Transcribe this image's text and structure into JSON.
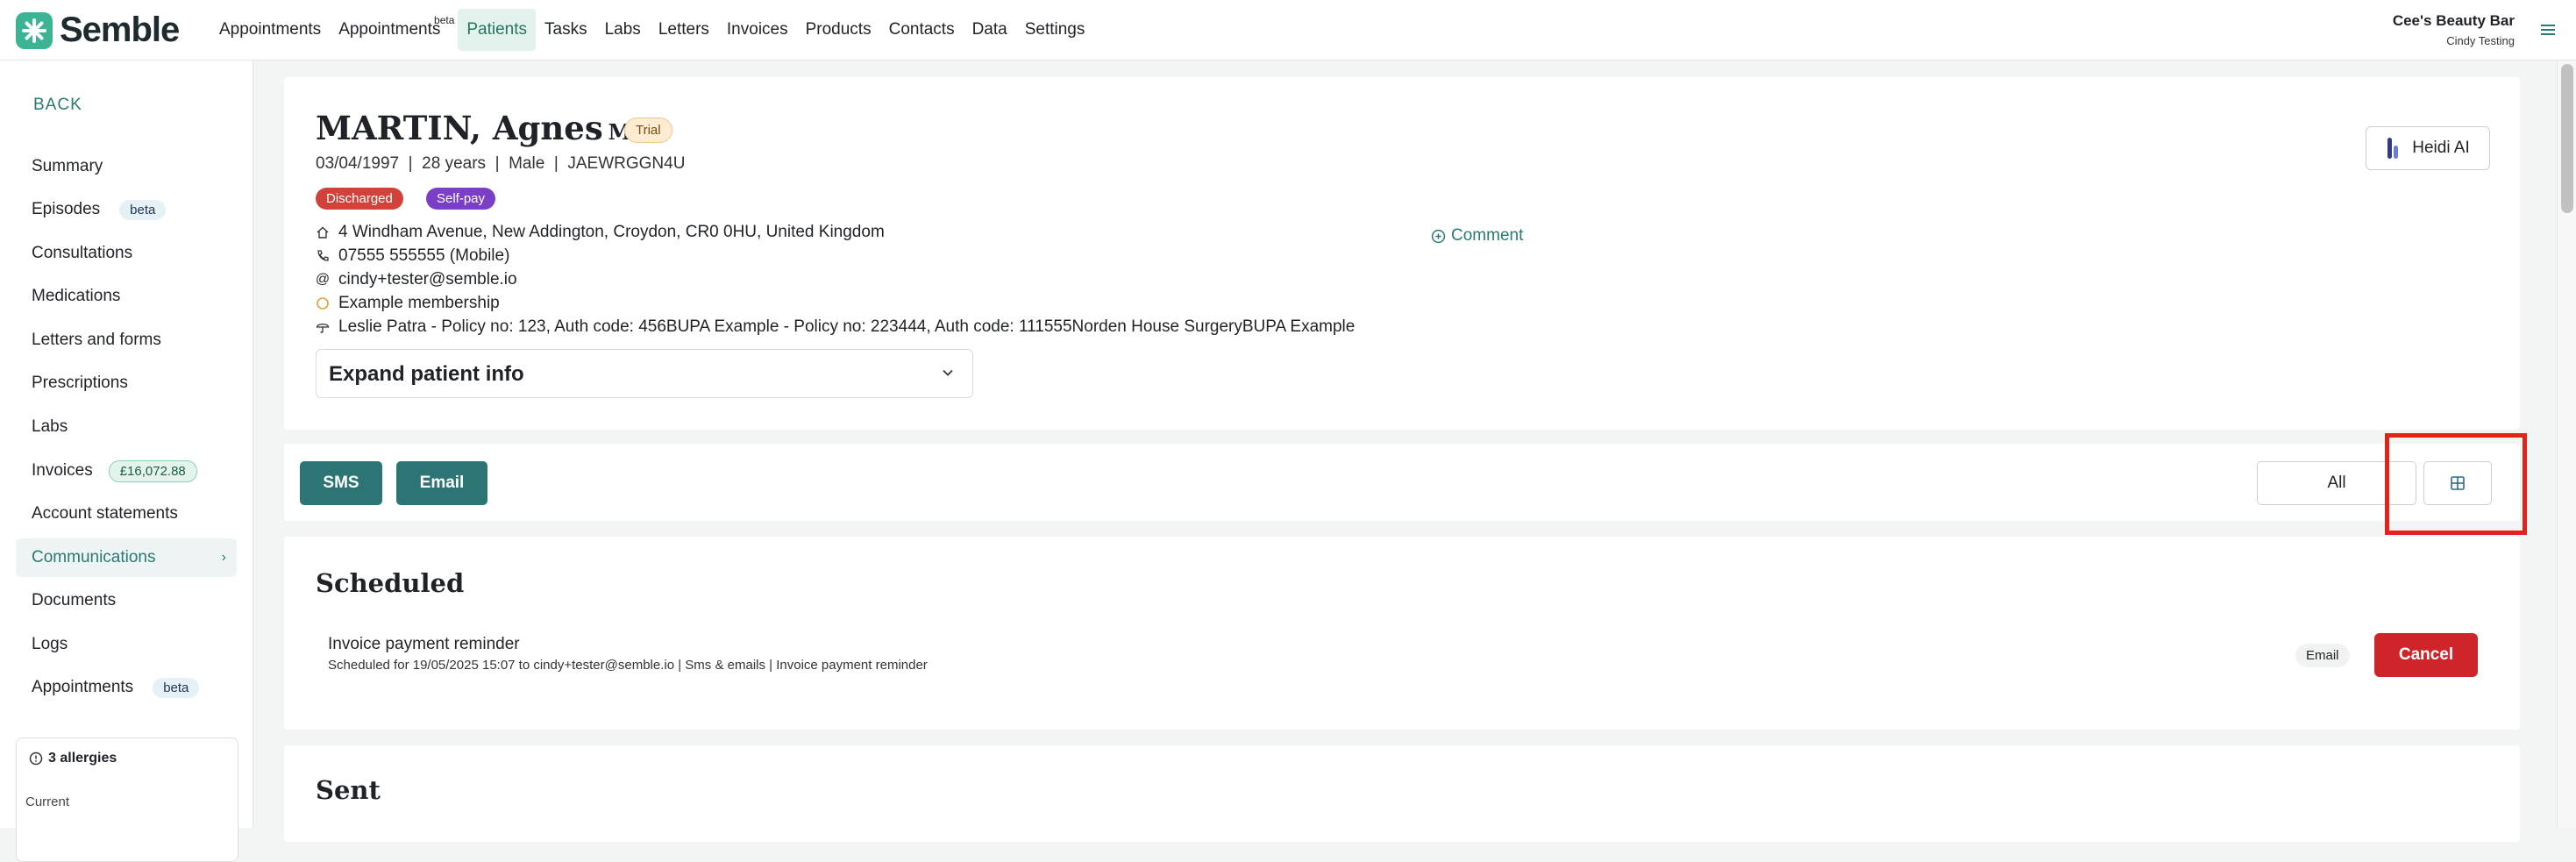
{
  "app": {
    "logo_text": "Semble",
    "brand_color": "#3bb494",
    "accent_color": "#2d7574",
    "danger_color": "#d0242b"
  },
  "nav": {
    "items": [
      {
        "label": "Appointments"
      },
      {
        "label": "Appointments",
        "sup": "beta"
      },
      {
        "label": "Patients",
        "active": true
      },
      {
        "label": "Tasks"
      },
      {
        "label": "Labs"
      },
      {
        "label": "Letters"
      },
      {
        "label": "Invoices"
      },
      {
        "label": "Products"
      },
      {
        "label": "Contacts"
      },
      {
        "label": "Data"
      },
      {
        "label": "Settings"
      }
    ],
    "org_name": "Cee's Beauty Bar",
    "user_name": "Cindy Testing",
    "menu_icon": "hamburger-icon"
  },
  "sidebar": {
    "back_label": "BACK",
    "items": [
      {
        "label": "Summary"
      },
      {
        "label": "Episodes",
        "badge": "beta"
      },
      {
        "label": "Consultations"
      },
      {
        "label": "Medications"
      },
      {
        "label": "Letters and forms"
      },
      {
        "label": "Prescriptions"
      },
      {
        "label": "Labs"
      },
      {
        "label": "Invoices",
        "badge": "£16,072.88"
      },
      {
        "label": "Account statements"
      },
      {
        "label": "Communications",
        "active": true
      },
      {
        "label": "Documents"
      },
      {
        "label": "Logs"
      },
      {
        "label": "Appointments",
        "badge": "beta"
      }
    ],
    "allergies": {
      "title": "3 allergies",
      "current_label": "Current"
    }
  },
  "patient": {
    "name": "MARTIN, Agnes",
    "title": "Mrs",
    "status_badge": "Trial",
    "dob": "03/04/1997",
    "age": "28 years",
    "gender": "Male",
    "id": "JAEWRGGN4U",
    "tags": [
      {
        "label": "Discharged",
        "color": "#d1423a"
      },
      {
        "label": "Self-pay",
        "color": "#7b3fc7"
      }
    ],
    "address": "4 Windham Avenue, New Addington, Croydon, CR0 0HU, United Kingdom",
    "phone": "07555 555555 (Mobile)",
    "email": "cindy+tester@semble.io",
    "membership": "Example membership",
    "insurance": "Leslie Patra - Policy no: 123, Auth code: 456BUPA Example - Policy no: 223444, Auth code: 111555Norden House SurgeryBUPA Example",
    "comment_label": "Comment",
    "heidi_label": "Heidi AI",
    "expand_label": "Expand patient info"
  },
  "actions": {
    "sms_label": "SMS",
    "email_label": "Email",
    "filter_label": "All",
    "grid_icon": "grid-view-icon"
  },
  "scheduled": {
    "title": "Scheduled",
    "item": {
      "title": "Invoice payment reminder",
      "subtitle": "Scheduled for 19/05/2025 15:07 to cindy+tester@semble.io | Sms & emails | Invoice payment reminder",
      "channel": "Email",
      "cancel_label": "Cancel"
    }
  },
  "sent": {
    "title": "Sent"
  }
}
